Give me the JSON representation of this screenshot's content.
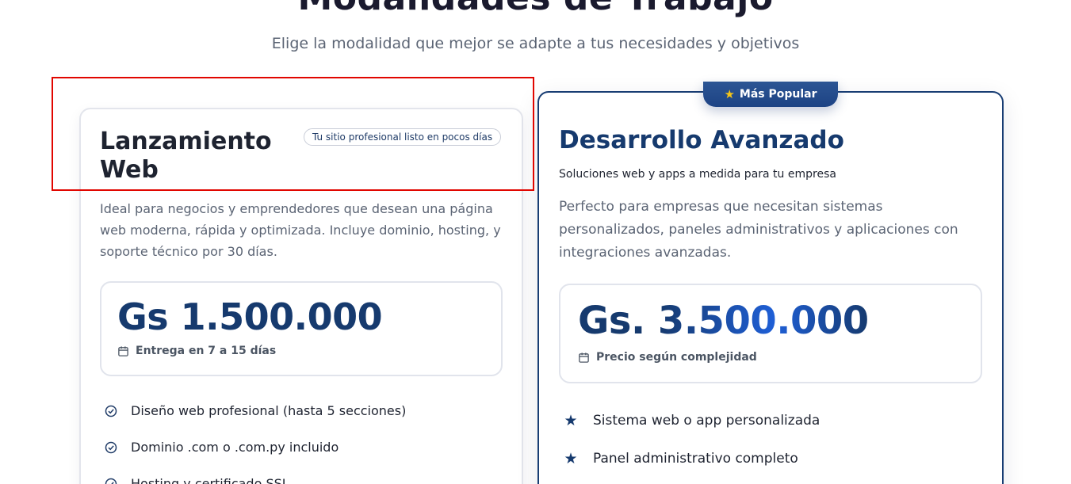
{
  "section": {
    "title": "Modalidades de Trabajo",
    "subtitle": "Elige la modalidad que mejor se adapte a tus necesidades y objetivos"
  },
  "plans": [
    {
      "title": "Lanzamiento Web",
      "tag": "Tu sitio profesional listo en pocos días",
      "description": "Ideal para negocios y emprendedores que desean una página web moderna, rápida y optimizada. Incluye dominio, hosting, y soporte técnico por 30 días.",
      "price": "Gs 1.500.000",
      "note": "Entrega en 7 a 15 días",
      "note_icon": "calendar-icon",
      "feature_icon": "check-circle-icon",
      "features": [
        "Diseño web profesional (hasta 5 secciones)",
        "Dominio .com o .com.py incluido",
        "Hosting y certificado SSL"
      ]
    },
    {
      "badge": "Más Popular",
      "badge_icon": "star-icon",
      "title": "Desarrollo Avanzado",
      "tagline": "Soluciones web y apps a medida para tu empresa",
      "description": "Perfecto para empresas que necesitan sistemas personalizados, paneles administrativos y aplicaciones con integraciones avanzadas.",
      "price_prefix": "Gs.",
      "price_number": "3.500.000",
      "note": "Precio según complejidad",
      "note_icon": "calendar-icon",
      "feature_icon": "star-icon",
      "features": [
        "Sistema web o app personalizada",
        "Panel administrativo completo"
      ]
    }
  ],
  "colors": {
    "brand_navy": "#163a6e",
    "accent_blue": "#1f5fd6",
    "badge_star": "#f5c518",
    "highlight_red": "#e10600"
  }
}
